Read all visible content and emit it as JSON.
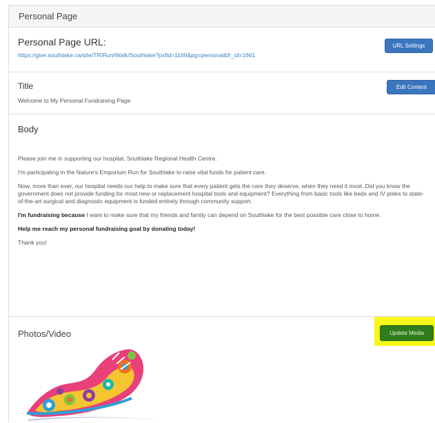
{
  "panel": {
    "heading": "Personal Page"
  },
  "url_section": {
    "label": "Personal Page URL:",
    "link": "https://give.southlake.ca/site/TR/Run/Walk/Southlake?pxfid=1169&pg=personal&fr_id=1661",
    "button": "URL Settings"
  },
  "title_section": {
    "label": "Title",
    "value": "Welcome to My Personal Fundraising Page",
    "button": "Edit Content"
  },
  "body_section": {
    "label": "Body",
    "p1": "Please join me in supporting our hospital, Southlake Regional Health Centre.",
    "p2": "I'm participating in the Nature's Emporium Run for Southlake to raise vital funds for patient care.",
    "p3": "Now, more than ever, our hospital needs our help to make sure that every patient gets the care they deserve, when they need it most. Did you know the government does not provide funding for most new or replacement hospital tools and equipment? Everything from basic tools like beds and IV poles to state-of-the-art surgical and diagnostic equipment is funded entirely through community support.",
    "p4_bold": "I'm fundraising because",
    "p4_rest": " I want to make sure that my friends and family can depend on Southlake for the best possible care close to home.",
    "p5": "Help me reach my personal fundraising goal by donating today!",
    "p6": "Thank you!"
  },
  "photos_section": {
    "label": "Photos/Video",
    "button": "Update Media",
    "image": "colorful-running-shoe-logo"
  },
  "colors": {
    "primary_button": "#3b75bd",
    "media_button": "#2f7d1d",
    "highlight": "#f6f81a",
    "link": "#3a7fc4"
  }
}
